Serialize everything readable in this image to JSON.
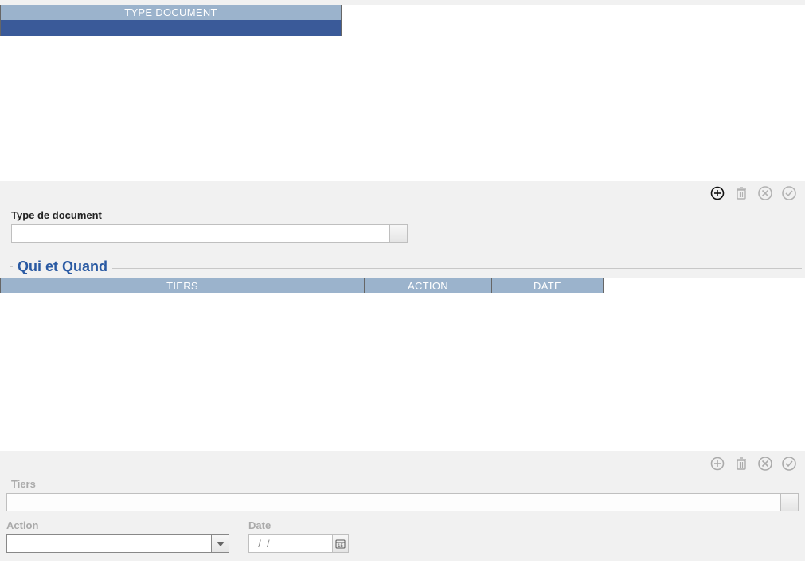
{
  "grid1": {
    "header": "TYPE DOCUMENT"
  },
  "form1": {
    "type_document_label": "Type de document",
    "type_document_value": ""
  },
  "section2": {
    "title": "Qui et Quand"
  },
  "grid2": {
    "headers": {
      "tiers": "TIERS",
      "action": "ACTION",
      "date": "DATE"
    }
  },
  "form2": {
    "tiers_label": "Tiers",
    "tiers_value": "",
    "action_label": "Action",
    "action_value": "",
    "date_label": "Date",
    "date_value": "  /  /"
  },
  "icons": {
    "add": "add-icon",
    "delete": "trash-icon",
    "cancel": "cancel-circle-icon",
    "confirm": "check-circle-icon"
  }
}
